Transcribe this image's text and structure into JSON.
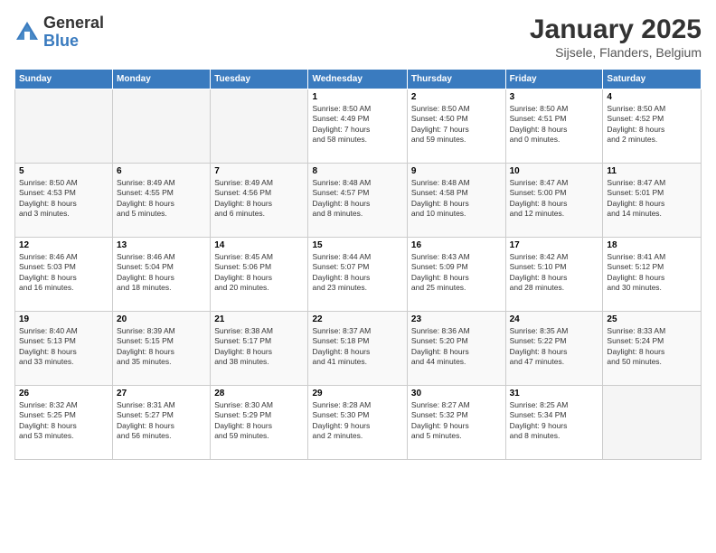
{
  "header": {
    "logo_general": "General",
    "logo_blue": "Blue",
    "month": "January 2025",
    "location": "Sijsele, Flanders, Belgium"
  },
  "weekdays": [
    "Sunday",
    "Monday",
    "Tuesday",
    "Wednesday",
    "Thursday",
    "Friday",
    "Saturday"
  ],
  "weeks": [
    [
      {
        "day": "",
        "info": ""
      },
      {
        "day": "",
        "info": ""
      },
      {
        "day": "",
        "info": ""
      },
      {
        "day": "1",
        "info": "Sunrise: 8:50 AM\nSunset: 4:49 PM\nDaylight: 7 hours\nand 58 minutes."
      },
      {
        "day": "2",
        "info": "Sunrise: 8:50 AM\nSunset: 4:50 PM\nDaylight: 7 hours\nand 59 minutes."
      },
      {
        "day": "3",
        "info": "Sunrise: 8:50 AM\nSunset: 4:51 PM\nDaylight: 8 hours\nand 0 minutes."
      },
      {
        "day": "4",
        "info": "Sunrise: 8:50 AM\nSunset: 4:52 PM\nDaylight: 8 hours\nand 2 minutes."
      }
    ],
    [
      {
        "day": "5",
        "info": "Sunrise: 8:50 AM\nSunset: 4:53 PM\nDaylight: 8 hours\nand 3 minutes."
      },
      {
        "day": "6",
        "info": "Sunrise: 8:49 AM\nSunset: 4:55 PM\nDaylight: 8 hours\nand 5 minutes."
      },
      {
        "day": "7",
        "info": "Sunrise: 8:49 AM\nSunset: 4:56 PM\nDaylight: 8 hours\nand 6 minutes."
      },
      {
        "day": "8",
        "info": "Sunrise: 8:48 AM\nSunset: 4:57 PM\nDaylight: 8 hours\nand 8 minutes."
      },
      {
        "day": "9",
        "info": "Sunrise: 8:48 AM\nSunset: 4:58 PM\nDaylight: 8 hours\nand 10 minutes."
      },
      {
        "day": "10",
        "info": "Sunrise: 8:47 AM\nSunset: 5:00 PM\nDaylight: 8 hours\nand 12 minutes."
      },
      {
        "day": "11",
        "info": "Sunrise: 8:47 AM\nSunset: 5:01 PM\nDaylight: 8 hours\nand 14 minutes."
      }
    ],
    [
      {
        "day": "12",
        "info": "Sunrise: 8:46 AM\nSunset: 5:03 PM\nDaylight: 8 hours\nand 16 minutes."
      },
      {
        "day": "13",
        "info": "Sunrise: 8:46 AM\nSunset: 5:04 PM\nDaylight: 8 hours\nand 18 minutes."
      },
      {
        "day": "14",
        "info": "Sunrise: 8:45 AM\nSunset: 5:06 PM\nDaylight: 8 hours\nand 20 minutes."
      },
      {
        "day": "15",
        "info": "Sunrise: 8:44 AM\nSunset: 5:07 PM\nDaylight: 8 hours\nand 23 minutes."
      },
      {
        "day": "16",
        "info": "Sunrise: 8:43 AM\nSunset: 5:09 PM\nDaylight: 8 hours\nand 25 minutes."
      },
      {
        "day": "17",
        "info": "Sunrise: 8:42 AM\nSunset: 5:10 PM\nDaylight: 8 hours\nand 28 minutes."
      },
      {
        "day": "18",
        "info": "Sunrise: 8:41 AM\nSunset: 5:12 PM\nDaylight: 8 hours\nand 30 minutes."
      }
    ],
    [
      {
        "day": "19",
        "info": "Sunrise: 8:40 AM\nSunset: 5:13 PM\nDaylight: 8 hours\nand 33 minutes."
      },
      {
        "day": "20",
        "info": "Sunrise: 8:39 AM\nSunset: 5:15 PM\nDaylight: 8 hours\nand 35 minutes."
      },
      {
        "day": "21",
        "info": "Sunrise: 8:38 AM\nSunset: 5:17 PM\nDaylight: 8 hours\nand 38 minutes."
      },
      {
        "day": "22",
        "info": "Sunrise: 8:37 AM\nSunset: 5:18 PM\nDaylight: 8 hours\nand 41 minutes."
      },
      {
        "day": "23",
        "info": "Sunrise: 8:36 AM\nSunset: 5:20 PM\nDaylight: 8 hours\nand 44 minutes."
      },
      {
        "day": "24",
        "info": "Sunrise: 8:35 AM\nSunset: 5:22 PM\nDaylight: 8 hours\nand 47 minutes."
      },
      {
        "day": "25",
        "info": "Sunrise: 8:33 AM\nSunset: 5:24 PM\nDaylight: 8 hours\nand 50 minutes."
      }
    ],
    [
      {
        "day": "26",
        "info": "Sunrise: 8:32 AM\nSunset: 5:25 PM\nDaylight: 8 hours\nand 53 minutes."
      },
      {
        "day": "27",
        "info": "Sunrise: 8:31 AM\nSunset: 5:27 PM\nDaylight: 8 hours\nand 56 minutes."
      },
      {
        "day": "28",
        "info": "Sunrise: 8:30 AM\nSunset: 5:29 PM\nDaylight: 8 hours\nand 59 minutes."
      },
      {
        "day": "29",
        "info": "Sunrise: 8:28 AM\nSunset: 5:30 PM\nDaylight: 9 hours\nand 2 minutes."
      },
      {
        "day": "30",
        "info": "Sunrise: 8:27 AM\nSunset: 5:32 PM\nDaylight: 9 hours\nand 5 minutes."
      },
      {
        "day": "31",
        "info": "Sunrise: 8:25 AM\nSunset: 5:34 PM\nDaylight: 9 hours\nand 8 minutes."
      },
      {
        "day": "",
        "info": ""
      }
    ]
  ]
}
